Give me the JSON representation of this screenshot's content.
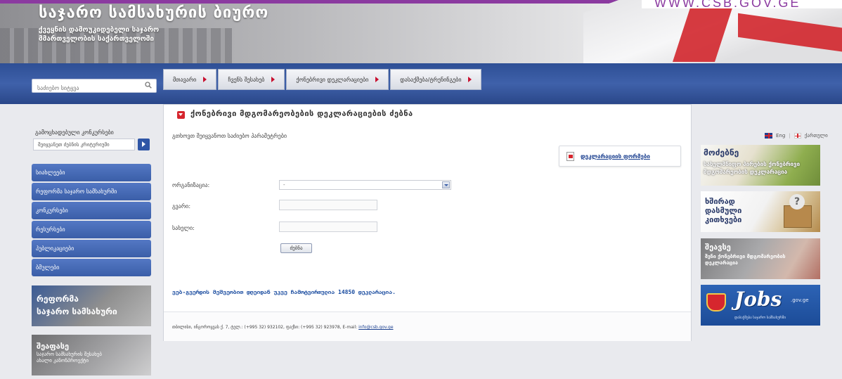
{
  "header": {
    "url": "WWW.CSB.GOV.GE",
    "title": "საჯარო სამსახურის ბიურო",
    "subtitle": "ქვეყნის დამოუკიდებელი საჯარო მმართველობის საქართველოში"
  },
  "search": {
    "placeholder": "საძიებო სიტყვა"
  },
  "nav": {
    "items": [
      {
        "label": "მთავარი"
      },
      {
        "label": "ჩვენს შესახებ"
      },
      {
        "label": "ქონებრივი დეკლარაციები"
      },
      {
        "label": "დასაქმება/ტრენინგები"
      }
    ]
  },
  "left": {
    "competitions_title": "გამოცხადებული კონკურსები",
    "competitions_select": "შეიყვანეთ ძებნის კრიტერიუმი",
    "menu": [
      {
        "label": "სიახლეები"
      },
      {
        "label": "რეფორმა საჯარო სამსახურში"
      },
      {
        "label": "კონკურსები"
      },
      {
        "label": "რესურსები"
      },
      {
        "label": "პუბლიკაციები"
      },
      {
        "label": "ბმულები"
      }
    ],
    "banner_reform": {
      "line1": "რეფორმა",
      "line2": "საჯარო სამსახური"
    },
    "banner_law": {
      "line1": "შეაფასე",
      "line2": "საჯარო სამსახურის შესახებ ახალი კანონპროექტი"
    }
  },
  "main": {
    "title": "ქონებრივი მდგომარეობების დეკლარაციების ძებნა",
    "instruction": "გთხოვთ შეიყვანოთ საძიებო პარამეტრები",
    "pdf_link": "დეკლარაციის ფორმები",
    "form": {
      "org_label": "ორგანიზაცია:",
      "org_value": "-",
      "surname_label": "გვარი:",
      "name_label": "სახელი:",
      "search_button": "ძებნა"
    },
    "stat": "ვებ-გვერდის მეშვეობით დღეიდან უკვე ჩამოტვირთულია 14850 დეკლარაცია.",
    "footer": {
      "address": "თბილისი, ინგოროყვას ქ. 7, ტელ.: (+995 32) 932102, ფაქსი: (+995 32) 923978, E-mail: ",
      "email": "info@csb.gov.ge"
    }
  },
  "right": {
    "lang_eng": "Eng",
    "lang_geo": "ქართული",
    "banner_declaration": {
      "line1": "მოძებნე",
      "line2": "სახელმწიფო პირების ქონებრივი მდგომარეობის დეკლარაცია"
    },
    "banner_faq": {
      "line1": "ხშირად დასმული კითხვები"
    },
    "banner_fill": {
      "line1": "შეავსე",
      "line2": "შენი ქონებრივი მდგომარეობის დეკლარაცია"
    },
    "banner_jobs": {
      "logo": "Jobs",
      "domain": ".gov.ge",
      "line2": "დასაქმება საჯარო სამსახურში"
    }
  }
}
